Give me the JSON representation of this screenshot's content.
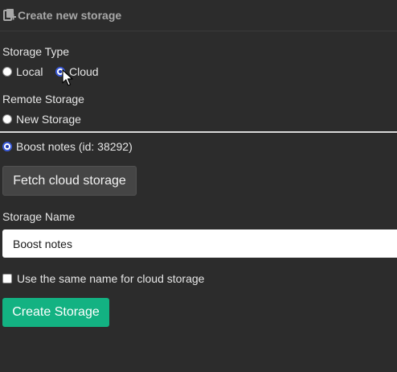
{
  "header": {
    "title": "Create new storage",
    "icon": "storage-add-icon"
  },
  "storage_type": {
    "label": "Storage Type",
    "options": [
      {
        "label": "Local",
        "selected": false
      },
      {
        "label": "Cloud",
        "selected": true
      }
    ]
  },
  "remote_storage": {
    "label": "Remote Storage",
    "options": [
      {
        "label": "New Storage",
        "selected": false
      },
      {
        "label": "Boost notes (id: 38292)",
        "selected": true
      }
    ]
  },
  "fetch_button": {
    "label": "Fetch cloud storage"
  },
  "storage_name": {
    "label": "Storage Name",
    "value": "Boost notes"
  },
  "same_name_checkbox": {
    "label": "Use the same name for cloud storage",
    "checked": false
  },
  "create_button": {
    "label": "Create Storage"
  },
  "colors": {
    "background": "#2c2c2c",
    "accent": "#13b282",
    "radio_selected": "#3b5bdb"
  }
}
